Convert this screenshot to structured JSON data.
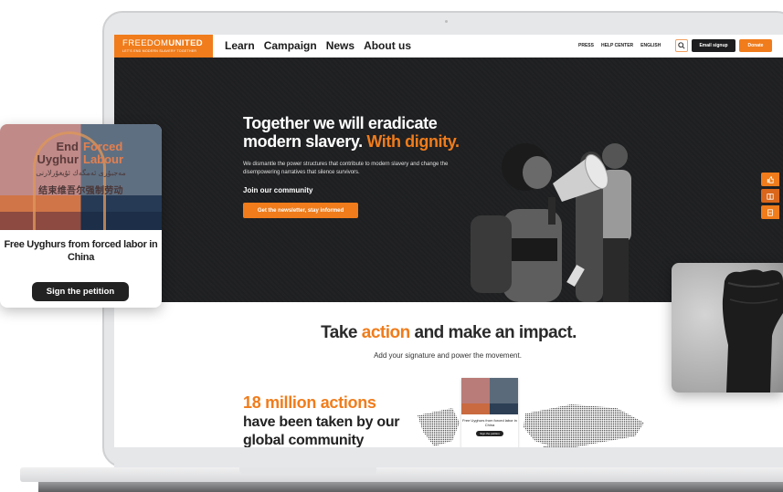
{
  "site": {
    "logo": {
      "name_light": "FREEDOM",
      "name_bold": "UNITED",
      "tagline": "LET'S END MODERN SLAVERY TOGETHER"
    },
    "nav": {
      "links": [
        {
          "label": "Learn"
        },
        {
          "label": "Campaign"
        },
        {
          "label": "News"
        },
        {
          "label": "About us"
        }
      ],
      "utility_links": [
        {
          "label": "PRESS"
        },
        {
          "label": "HELP CENTER"
        },
        {
          "label": "ENGLISH"
        }
      ],
      "search_icon": "search-icon",
      "email_signup_label": "Email signup",
      "donate_label": "Donate"
    },
    "hero": {
      "title_main": "Together we will eradicate modern slavery. ",
      "title_accent": "With dignity.",
      "text": "We dismantle the power structures that contribute to modern slavery and change the disempowering narratives that silence survivors.",
      "join_label": "Join our community",
      "cta_label": "Get the newsletter, stay informed",
      "side_tabs": [
        {
          "icon": "thumbs-up-icon"
        },
        {
          "icon": "book-icon"
        },
        {
          "icon": "document-icon"
        }
      ]
    },
    "action": {
      "title_start": "Take ",
      "title_accent": "action",
      "title_end": " and make an impact.",
      "subtitle": "Add your signature and power the movement.",
      "stat_highlight": "18 million actions",
      "stat_rest": "have been taken by our global community"
    },
    "mini_card": {
      "title": "Free Uyghurs from forced labor in China",
      "button_label": "Sign the petition"
    }
  },
  "petition_card": {
    "image_text_left": "End\nUyghur",
    "image_text_right": "Forced\nLabour",
    "image_text_arabic": "مەجبۇرى ئەمگەك ئۇيغۇرلارنى",
    "image_text_chinese": "结束维吾尔强制劳动",
    "title": "Free Uyghurs from forced labor in China",
    "button_label": "Sign the petition"
  },
  "colors": {
    "accent": "#f07c1b",
    "dark": "#1e1f21",
    "button_dark": "#1d1d1f"
  }
}
